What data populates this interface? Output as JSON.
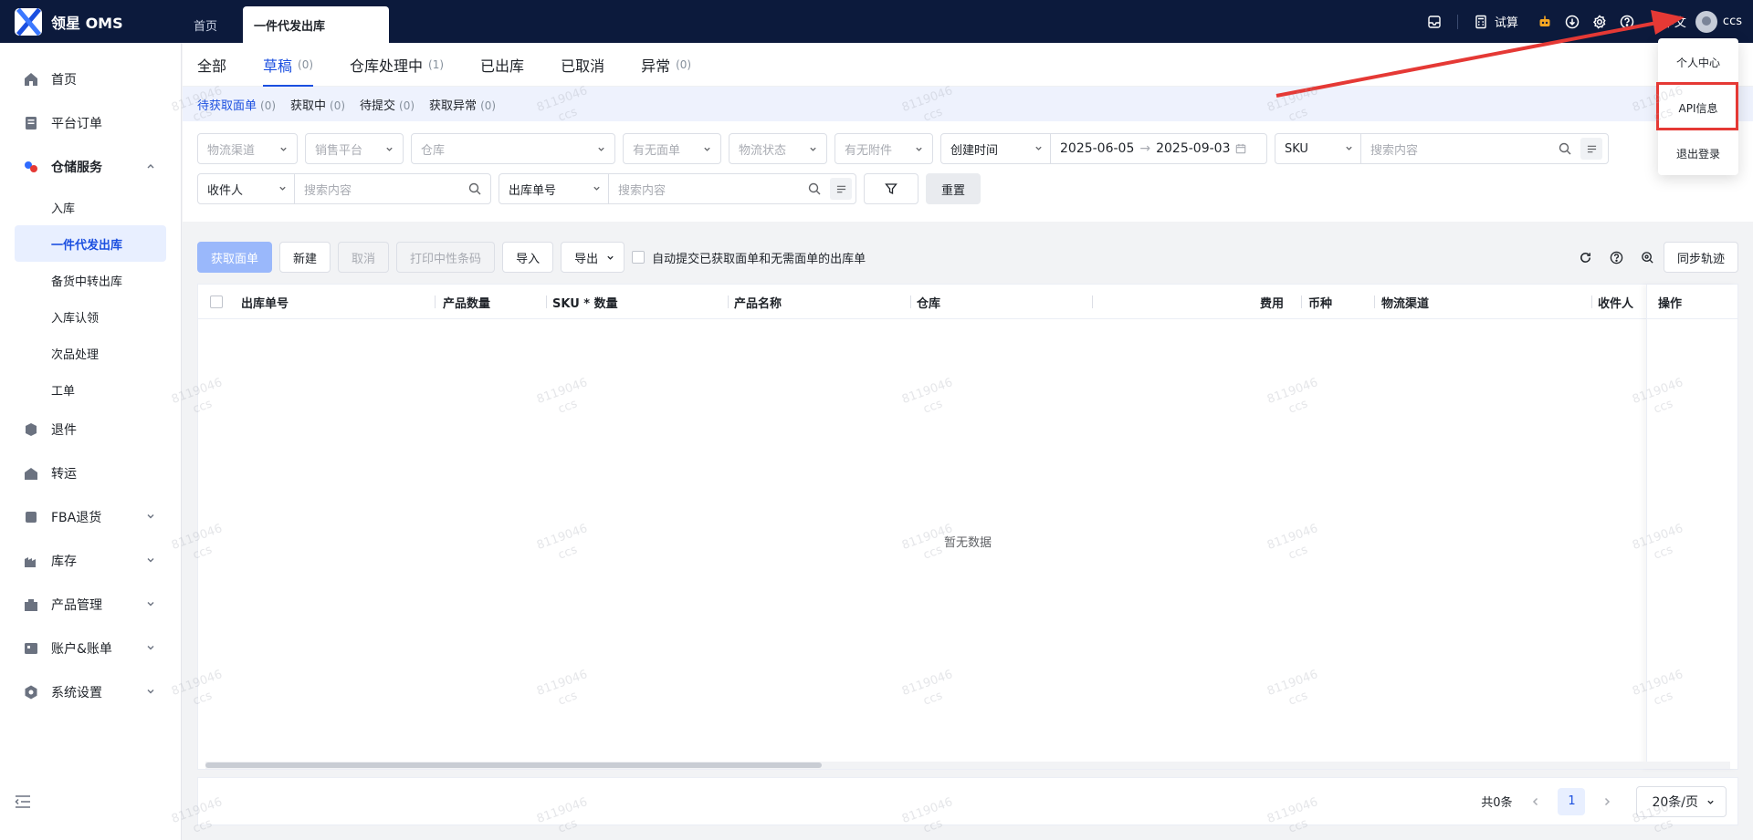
{
  "app": {
    "name": "领星 OMS"
  },
  "top_tabs": [
    {
      "label": "首页"
    },
    {
      "label": "一件代发出库"
    }
  ],
  "topbar": {
    "trial_calc_label": "试算",
    "language": "中文",
    "username": "ccs"
  },
  "user_menu": {
    "items": [
      {
        "label": "个人中心"
      },
      {
        "label": "API信息"
      },
      {
        "label": "退出登录"
      }
    ]
  },
  "sidebar": {
    "items": [
      {
        "label": "首页",
        "icon": "home-icon"
      },
      {
        "label": "平台订单",
        "icon": "order-icon"
      },
      {
        "label": "仓储服务",
        "icon": "warehouse-icon"
      },
      {
        "label": "退件",
        "icon": "return-icon"
      },
      {
        "label": "转运",
        "icon": "transfer-icon"
      },
      {
        "label": "FBA退货",
        "icon": "fba-icon"
      },
      {
        "label": "库存",
        "icon": "inventory-icon"
      },
      {
        "label": "产品管理",
        "icon": "product-icon"
      },
      {
        "label": "账户&账单",
        "icon": "account-icon"
      },
      {
        "label": "系统设置",
        "icon": "settings-icon"
      }
    ],
    "sub_items": [
      {
        "label": "入库"
      },
      {
        "label": "一件代发出库"
      },
      {
        "label": "备货中转出库"
      },
      {
        "label": "入库认领"
      },
      {
        "label": "次品处理"
      },
      {
        "label": "工单"
      }
    ]
  },
  "status_tabs": [
    {
      "label": "全部",
      "count": ""
    },
    {
      "label": "草稿",
      "count": "(0)"
    },
    {
      "label": "仓库处理中",
      "count": "(1)"
    },
    {
      "label": "已出库",
      "count": ""
    },
    {
      "label": "已取消",
      "count": ""
    },
    {
      "label": "异常",
      "count": "(0)"
    }
  ],
  "sub_tabs": [
    {
      "label": "待获取面单",
      "count": "(0)"
    },
    {
      "label": "获取中",
      "count": "(0)"
    },
    {
      "label": "待提交",
      "count": "(0)"
    },
    {
      "label": "获取异常",
      "count": "(0)"
    }
  ],
  "filters": {
    "row1": {
      "logistics_channel": "物流渠道",
      "sales_platform": "销售平台",
      "warehouse": "仓库",
      "has_label": "有无面单",
      "logistics_status": "物流状态",
      "has_attachment": "有无附件",
      "date_type": "创建时间",
      "date_start": "2025-06-05",
      "date_end": "2025-09-03",
      "sku_type": "SKU",
      "search_placeholder": "搜索内容"
    },
    "row2": {
      "recipient_type": "收件人",
      "recipient_placeholder": "搜索内容",
      "order_no_type": "出库单号",
      "order_no_placeholder": "搜索内容",
      "reset_label": "重置"
    }
  },
  "toolbar": {
    "get_label": "获取面单",
    "new": "新建",
    "cancel": "取消",
    "print_barcode": "打印中性条码",
    "import": "导入",
    "export": "导出",
    "auto_submit": "自动提交已获取面单和无需面单的出库单",
    "sync_track": "同步轨迹"
  },
  "table": {
    "columns": [
      "出库单号",
      "产品数量",
      "SKU * 数量",
      "产品名称",
      "仓库",
      "费用",
      "币种",
      "物流渠道",
      "收件人",
      "操作"
    ],
    "empty_text": "暂无数据"
  },
  "pagination": {
    "total": "共0条",
    "current_page": "1",
    "page_size": "20条/页"
  },
  "watermark": {
    "line1": "8119046",
    "line2": "ccs"
  },
  "colors": {
    "topbar": "#0c1a3c",
    "accent": "#1b4fe0",
    "annotation": "#e53935"
  }
}
